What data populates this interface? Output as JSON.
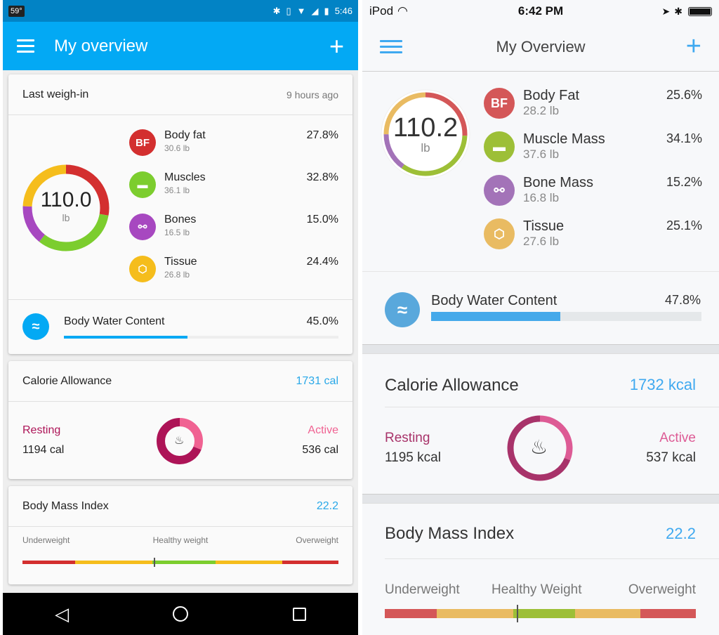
{
  "android": {
    "status": {
      "temp": "59°",
      "time": "5:46",
      "icons": [
        "bluetooth-icon",
        "vibrate-icon",
        "wifi-icon",
        "signal-icon",
        "battery-icon"
      ]
    },
    "appbar": {
      "title": "My overview",
      "add_label": "+"
    },
    "weighin": {
      "title": "Last weigh-in",
      "time_ago": "9 hours ago",
      "weight": "110.0",
      "unit": "lb",
      "items": [
        {
          "name": "Body fat",
          "sub": "30.6 lb",
          "pct": "27.8%",
          "color": "#d32f2f",
          "icon": "BF"
        },
        {
          "name": "Muscles",
          "sub": "36.1 lb",
          "pct": "32.8%",
          "color": "#7ccd2e",
          "icon": "dumbbell"
        },
        {
          "name": "Bones",
          "sub": "16.5 lb",
          "pct": "15.0%",
          "color": "#a748c0",
          "icon": "bone"
        },
        {
          "name": "Tissue",
          "sub": "26.8 lb",
          "pct": "24.4%",
          "color": "#f5bd1c",
          "icon": "hexagons"
        }
      ],
      "ring": [
        {
          "name": "Body fat",
          "value": 27.8,
          "color": "#d32f2f"
        },
        {
          "name": "Muscles",
          "value": 32.8,
          "color": "#7ccd2e"
        },
        {
          "name": "Bones",
          "value": 15.0,
          "color": "#a748c0"
        },
        {
          "name": "Tissue",
          "value": 24.4,
          "color": "#f5bd1c"
        }
      ],
      "water": {
        "label": "Body Water Content",
        "pct": "45.0%",
        "value": 45.0,
        "color": "#03a9f4"
      }
    },
    "calorie": {
      "title": "Calorie Allowance",
      "total": "1731 cal",
      "resting_label": "Resting",
      "resting": "1194 cal",
      "resting_value": 1194,
      "active_label": "Active",
      "active": "536 cal",
      "active_value": 536,
      "resting_color": "#ad1457",
      "active_color": "#f06292"
    },
    "bmi": {
      "title": "Body Mass Index",
      "value": "22.2",
      "labels": [
        "Underweight",
        "Healthy weight",
        "Overweight"
      ],
      "marker_fraction": 0.415
    }
  },
  "ios": {
    "status": {
      "carrier": "iPod",
      "time": "6:42 PM"
    },
    "nav": {
      "title": "My Overview",
      "add_label": "+"
    },
    "weighin": {
      "weight": "110.2",
      "unit": "lb",
      "items": [
        {
          "name": "Body Fat",
          "sub": "28.2 lb",
          "pct": "25.6%",
          "color": "#d45758",
          "icon": "BF"
        },
        {
          "name": "Muscle Mass",
          "sub": "37.6 lb",
          "pct": "34.1%",
          "color": "#9dbf37",
          "icon": "dumbbell"
        },
        {
          "name": "Bone Mass",
          "sub": "16.8 lb",
          "pct": "15.2%",
          "color": "#a373b8",
          "icon": "bone"
        },
        {
          "name": "Tissue",
          "sub": "27.6 lb",
          "pct": "25.1%",
          "color": "#e9bb62",
          "icon": "hexagons"
        }
      ],
      "ring": [
        {
          "name": "Body Fat",
          "value": 25.6,
          "color": "#d45758"
        },
        {
          "name": "Muscle Mass",
          "value": 34.1,
          "color": "#9dbf37"
        },
        {
          "name": "Bone Mass",
          "value": 15.2,
          "color": "#a373b8"
        },
        {
          "name": "Tissue",
          "value": 25.1,
          "color": "#e9bb62"
        }
      ],
      "water": {
        "label": "Body Water Content",
        "pct": "47.8%",
        "value": 47.8,
        "color": "#45a9ea"
      }
    },
    "calorie": {
      "title": "Calorie Allowance",
      "total": "1732 kcal",
      "resting_label": "Resting",
      "resting": "1195 kcal",
      "resting_value": 1195,
      "active_label": "Active",
      "active": "537 kcal",
      "active_value": 537,
      "resting_color": "#a8336a",
      "active_color": "#dd5b95"
    },
    "bmi": {
      "title": "Body Mass Index",
      "value": "22.2",
      "labels": [
        "Underweight",
        "Healthy Weight",
        "Overweight"
      ],
      "marker_fraction": 0.425
    }
  }
}
